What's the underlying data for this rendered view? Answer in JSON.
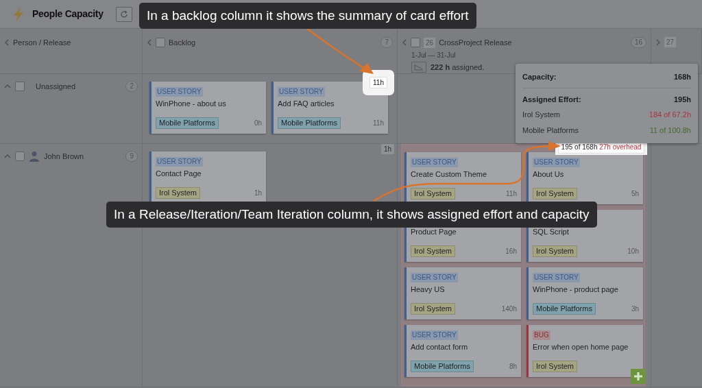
{
  "header": {
    "title": "People Capacity"
  },
  "columns": [
    {
      "kind": "person",
      "label": "Person / Release"
    },
    {
      "kind": "backlog",
      "label": "Backlog",
      "count": "7",
      "checked": false
    },
    {
      "kind": "release",
      "number": "26",
      "label": "CrossProject Release",
      "count": "16",
      "dates": "1-Jul — 31-Jul",
      "assigned": "**222 h** assigned.",
      "checked": false
    },
    {
      "kind": "next",
      "number": "27"
    }
  ],
  "rows": [
    {
      "name": "Unassigned",
      "count": "2",
      "expanded": true,
      "avatar": false,
      "checked": false,
      "backlog": {
        "summary": "11h",
        "highlighted": true,
        "cards": [
          {
            "type": "USER STORY",
            "kind": "story",
            "title": "WinPhone - about us",
            "tag": {
              "label": "Mobile Platforms",
              "color": "#7fa2ad"
            },
            "hours": "0h"
          },
          {
            "type": "USER STORY",
            "kind": "story",
            "title": "Add FAQ articles",
            "tag": {
              "label": "Mobile Platforms",
              "color": "#7fa2ad"
            },
            "hours": "11h"
          }
        ]
      }
    },
    {
      "name": "John Brown",
      "count": "9",
      "expanded": true,
      "avatar": true,
      "checked": false,
      "backlog": {
        "summary": "1h",
        "highlighted": false,
        "cards": [
          {
            "type": "USER STORY",
            "kind": "story",
            "title": "Contact Page",
            "tag": {
              "label": "Irol System",
              "color": "#a6a583"
            },
            "hours": "1h"
          }
        ]
      },
      "release": {
        "overloaded": true,
        "summary": "195 of 168h",
        "overhead": "27h overhead",
        "highlighted": true,
        "cards": [
          {
            "type": "USER STORY",
            "kind": "story",
            "title": "Create Custom Theme",
            "tag": {
              "label": "Irol System",
              "color": "#a6a583"
            },
            "hours": "11h"
          },
          {
            "type": "USER STORY",
            "kind": "story",
            "title": "About Us",
            "tag": {
              "label": "Irol System",
              "color": "#a6a583"
            },
            "hours": "5h"
          },
          {
            "kind": "story",
            "title": "Product Page",
            "tag": {
              "label": "Irol System",
              "color": "#a6a583"
            },
            "hours": "16h"
          },
          {
            "kind": "story",
            "title": "SQL Script",
            "tag": {
              "label": "Irol System",
              "color": "#a6a583"
            },
            "hours": "10h"
          },
          {
            "type": "USER STORY",
            "kind": "story",
            "title": "Heavy US",
            "tag": {
              "label": "Irol System",
              "color": "#a6a583"
            },
            "hours": "140h"
          },
          {
            "type": "USER STORY",
            "kind": "story",
            "title": "WinPhone - product page",
            "tag": {
              "label": "Mobile Platforms",
              "color": "#7fa2ad"
            },
            "hours": "3h"
          },
          {
            "type": "USER STORY",
            "kind": "story",
            "title": "Add contact form",
            "tag": {
              "label": "Mobile Platforms",
              "color": "#7fa2ad"
            },
            "hours": "8h"
          },
          {
            "type": "BUG",
            "kind": "bug",
            "title": "Error when open home page",
            "tag": {
              "label": "Irol System",
              "color": "#a6a583"
            }
          }
        ]
      }
    }
  ],
  "tooltip": {
    "rows": [
      {
        "kind": "heading",
        "label": "Capacity:",
        "value": "168h"
      },
      {
        "kind": "heading",
        "label": "Assigned Effort:",
        "value": "195h"
      },
      {
        "kind": "item",
        "label": "Irol System",
        "value": "184 of 67.2h",
        "color": "#a8323c"
      },
      {
        "kind": "item",
        "label": "Mobile Platforms",
        "value": "11 of 100.8h",
        "color": "#3f6b2c"
      }
    ]
  },
  "callouts": [
    {
      "text": "In a backlog column it shows the summary of card effort"
    },
    {
      "text": "In a Release/Iteration/Team Iteration column, it shows assigned effort and capacity"
    }
  ]
}
